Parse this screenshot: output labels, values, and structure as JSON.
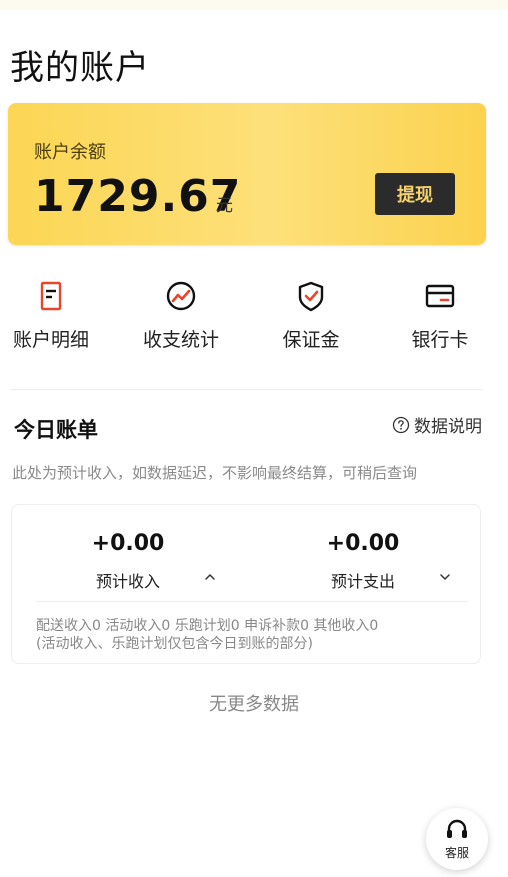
{
  "page": {
    "title": "我的账户"
  },
  "balance": {
    "label": "账户余额",
    "amount": "1729.67",
    "unit": "元",
    "withdraw_label": "提现"
  },
  "quick_nav": [
    {
      "label": "账户明细",
      "icon": "document-list-icon"
    },
    {
      "label": "收支统计",
      "icon": "trend-chart-icon"
    },
    {
      "label": "保证金",
      "icon": "shield-check-icon"
    },
    {
      "label": "银行卡",
      "icon": "bank-card-icon"
    }
  ],
  "today_bill": {
    "title": "今日账单",
    "help_label": "数据说明",
    "note": "此处为预计收入，如数据延迟，不影响最终结算，可稍后查询",
    "income": {
      "value": "+0.00",
      "label": "预计收入"
    },
    "expense": {
      "value": "+0.00",
      "label": "预计支出"
    },
    "breakdown_line1": "配送收入0 活动收入0 乐跑计划0 申诉补款0 其他收入0",
    "breakdown_line2": "(活动收入、乐跑计划仅包含今日到账的部分)"
  },
  "footer": {
    "no_more": "无更多数据"
  },
  "customer_service": {
    "label": "客服"
  },
  "colors": {
    "accent": "#fcd654",
    "accent_red": "#e8452c",
    "dark_button": "#2b2b2b"
  }
}
